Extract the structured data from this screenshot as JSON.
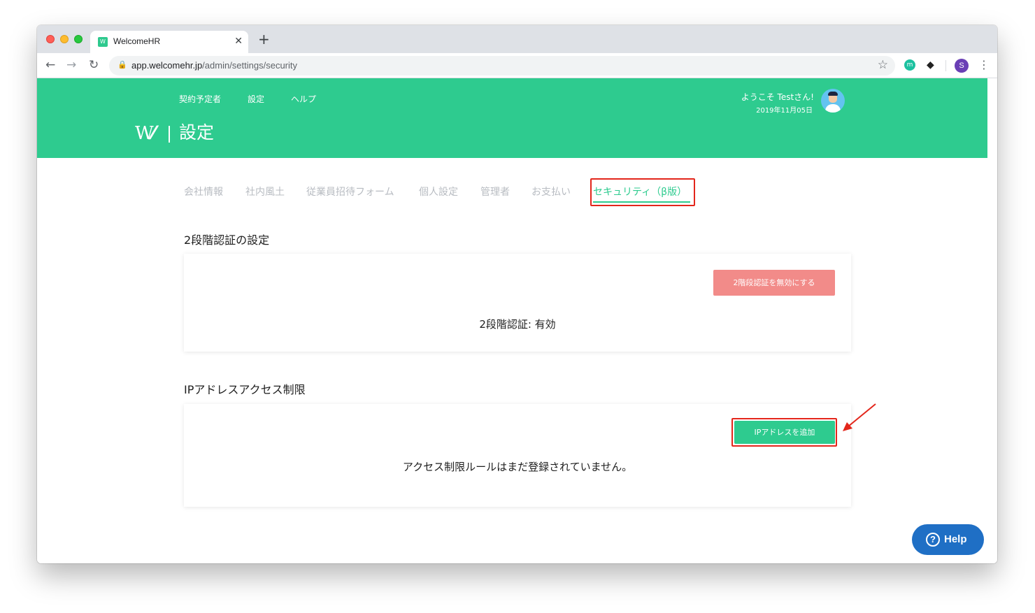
{
  "browser": {
    "tab_title": "WelcomeHR",
    "tab_favicon": "W",
    "url_host": "app.welcomehr.jp",
    "url_path": "/admin/settings/security",
    "profile_initial": "S",
    "ext1_label": "m"
  },
  "header": {
    "nav": [
      "契約予定者",
      "設定",
      "ヘルプ"
    ],
    "logo_text": "W/\\",
    "title": "設定",
    "welcome": "ようこそ Testさん!",
    "date": "2019年11月05日"
  },
  "settings_tabs": {
    "items": [
      "会社情報",
      "社内風土",
      "従業員招待フォーム",
      "個人設定",
      "管理者",
      "お支払い",
      "セキュリティ（β版）"
    ],
    "active_index": 6
  },
  "two_factor": {
    "title": "2段階認証の設定",
    "disable_button": "2階段認証を無効にする",
    "status": "2段階認証: 有効"
  },
  "ip_restriction": {
    "title": "IPアドレスアクセス制限",
    "add_button": "IPアドレスを追加",
    "empty_message": "アクセス制限ルールはまだ登録されていません。"
  },
  "help": {
    "label": "Help"
  },
  "colors": {
    "brand_green": "#2ecb8f",
    "danger_light": "#f28b89",
    "annotation_red": "#e3261b",
    "help_blue": "#1f6fc5"
  }
}
